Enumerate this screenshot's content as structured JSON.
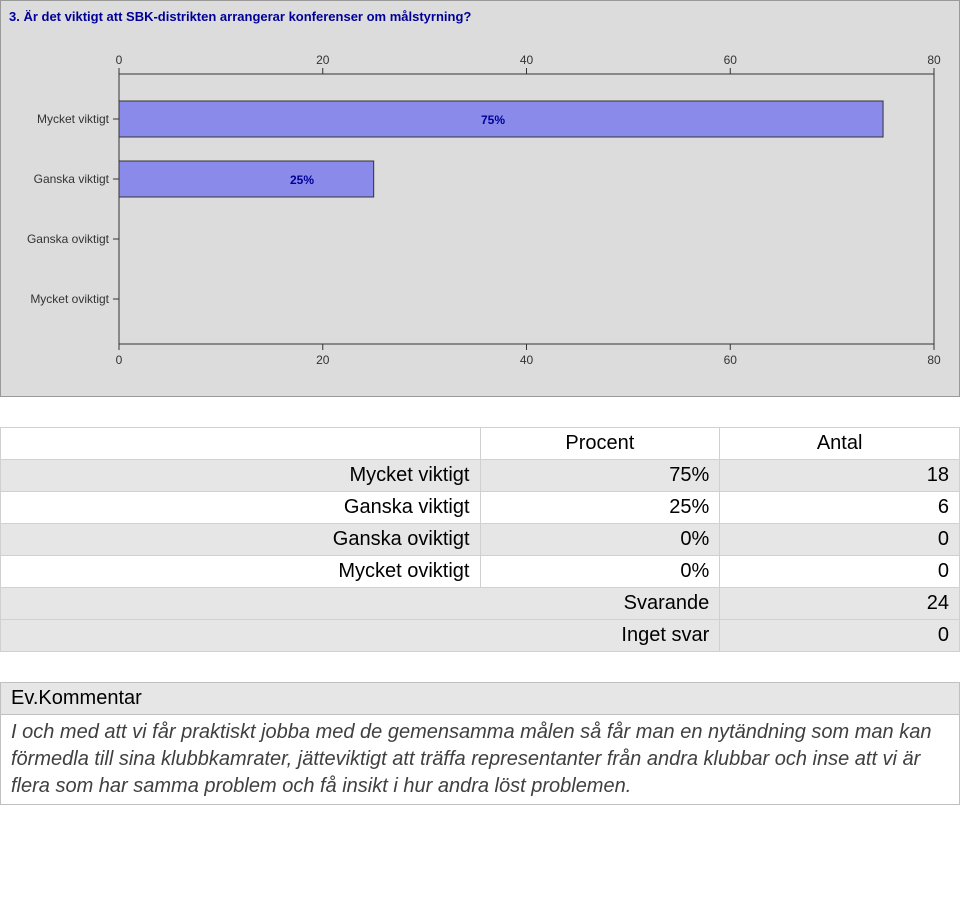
{
  "chart_data": {
    "type": "bar",
    "orientation": "horizontal",
    "title": "3. Är det viktigt att SBK-distrikten arrangerar konferenser om målstyrning?",
    "categories": [
      "Mycket viktigt",
      "Ganska viktigt",
      "Ganska oviktigt",
      "Mycket oviktigt"
    ],
    "values": [
      75,
      25,
      0,
      0
    ],
    "value_labels": [
      "75%",
      "25%",
      "",
      ""
    ],
    "xlim": [
      0,
      80
    ],
    "xticks": [
      0,
      20,
      40,
      60,
      80
    ],
    "xlabel": "",
    "ylabel": ""
  },
  "table": {
    "headers": {
      "procent": "Procent",
      "antal": "Antal"
    },
    "rows": [
      {
        "label": "Mycket viktigt",
        "procent": "75%",
        "antal": "18"
      },
      {
        "label": "Ganska viktigt",
        "procent": "25%",
        "antal": "6"
      },
      {
        "label": "Ganska oviktigt",
        "procent": "0%",
        "antal": "0"
      },
      {
        "label": "Mycket oviktigt",
        "procent": "0%",
        "antal": "0"
      }
    ],
    "summary": [
      {
        "label": "Svarande",
        "value": "24"
      },
      {
        "label": "Inget svar",
        "value": "0"
      }
    ]
  },
  "comment": {
    "heading": "Ev.Kommentar",
    "body": "I och med att vi får praktiskt jobba med de gemensamma målen så får man en nytändning som man kan förmedla till sina klubbkamrater, jätteviktigt att träffa representanter från andra klubbar och inse att vi är flera som har samma problem och få insikt i hur andra löst problemen."
  }
}
